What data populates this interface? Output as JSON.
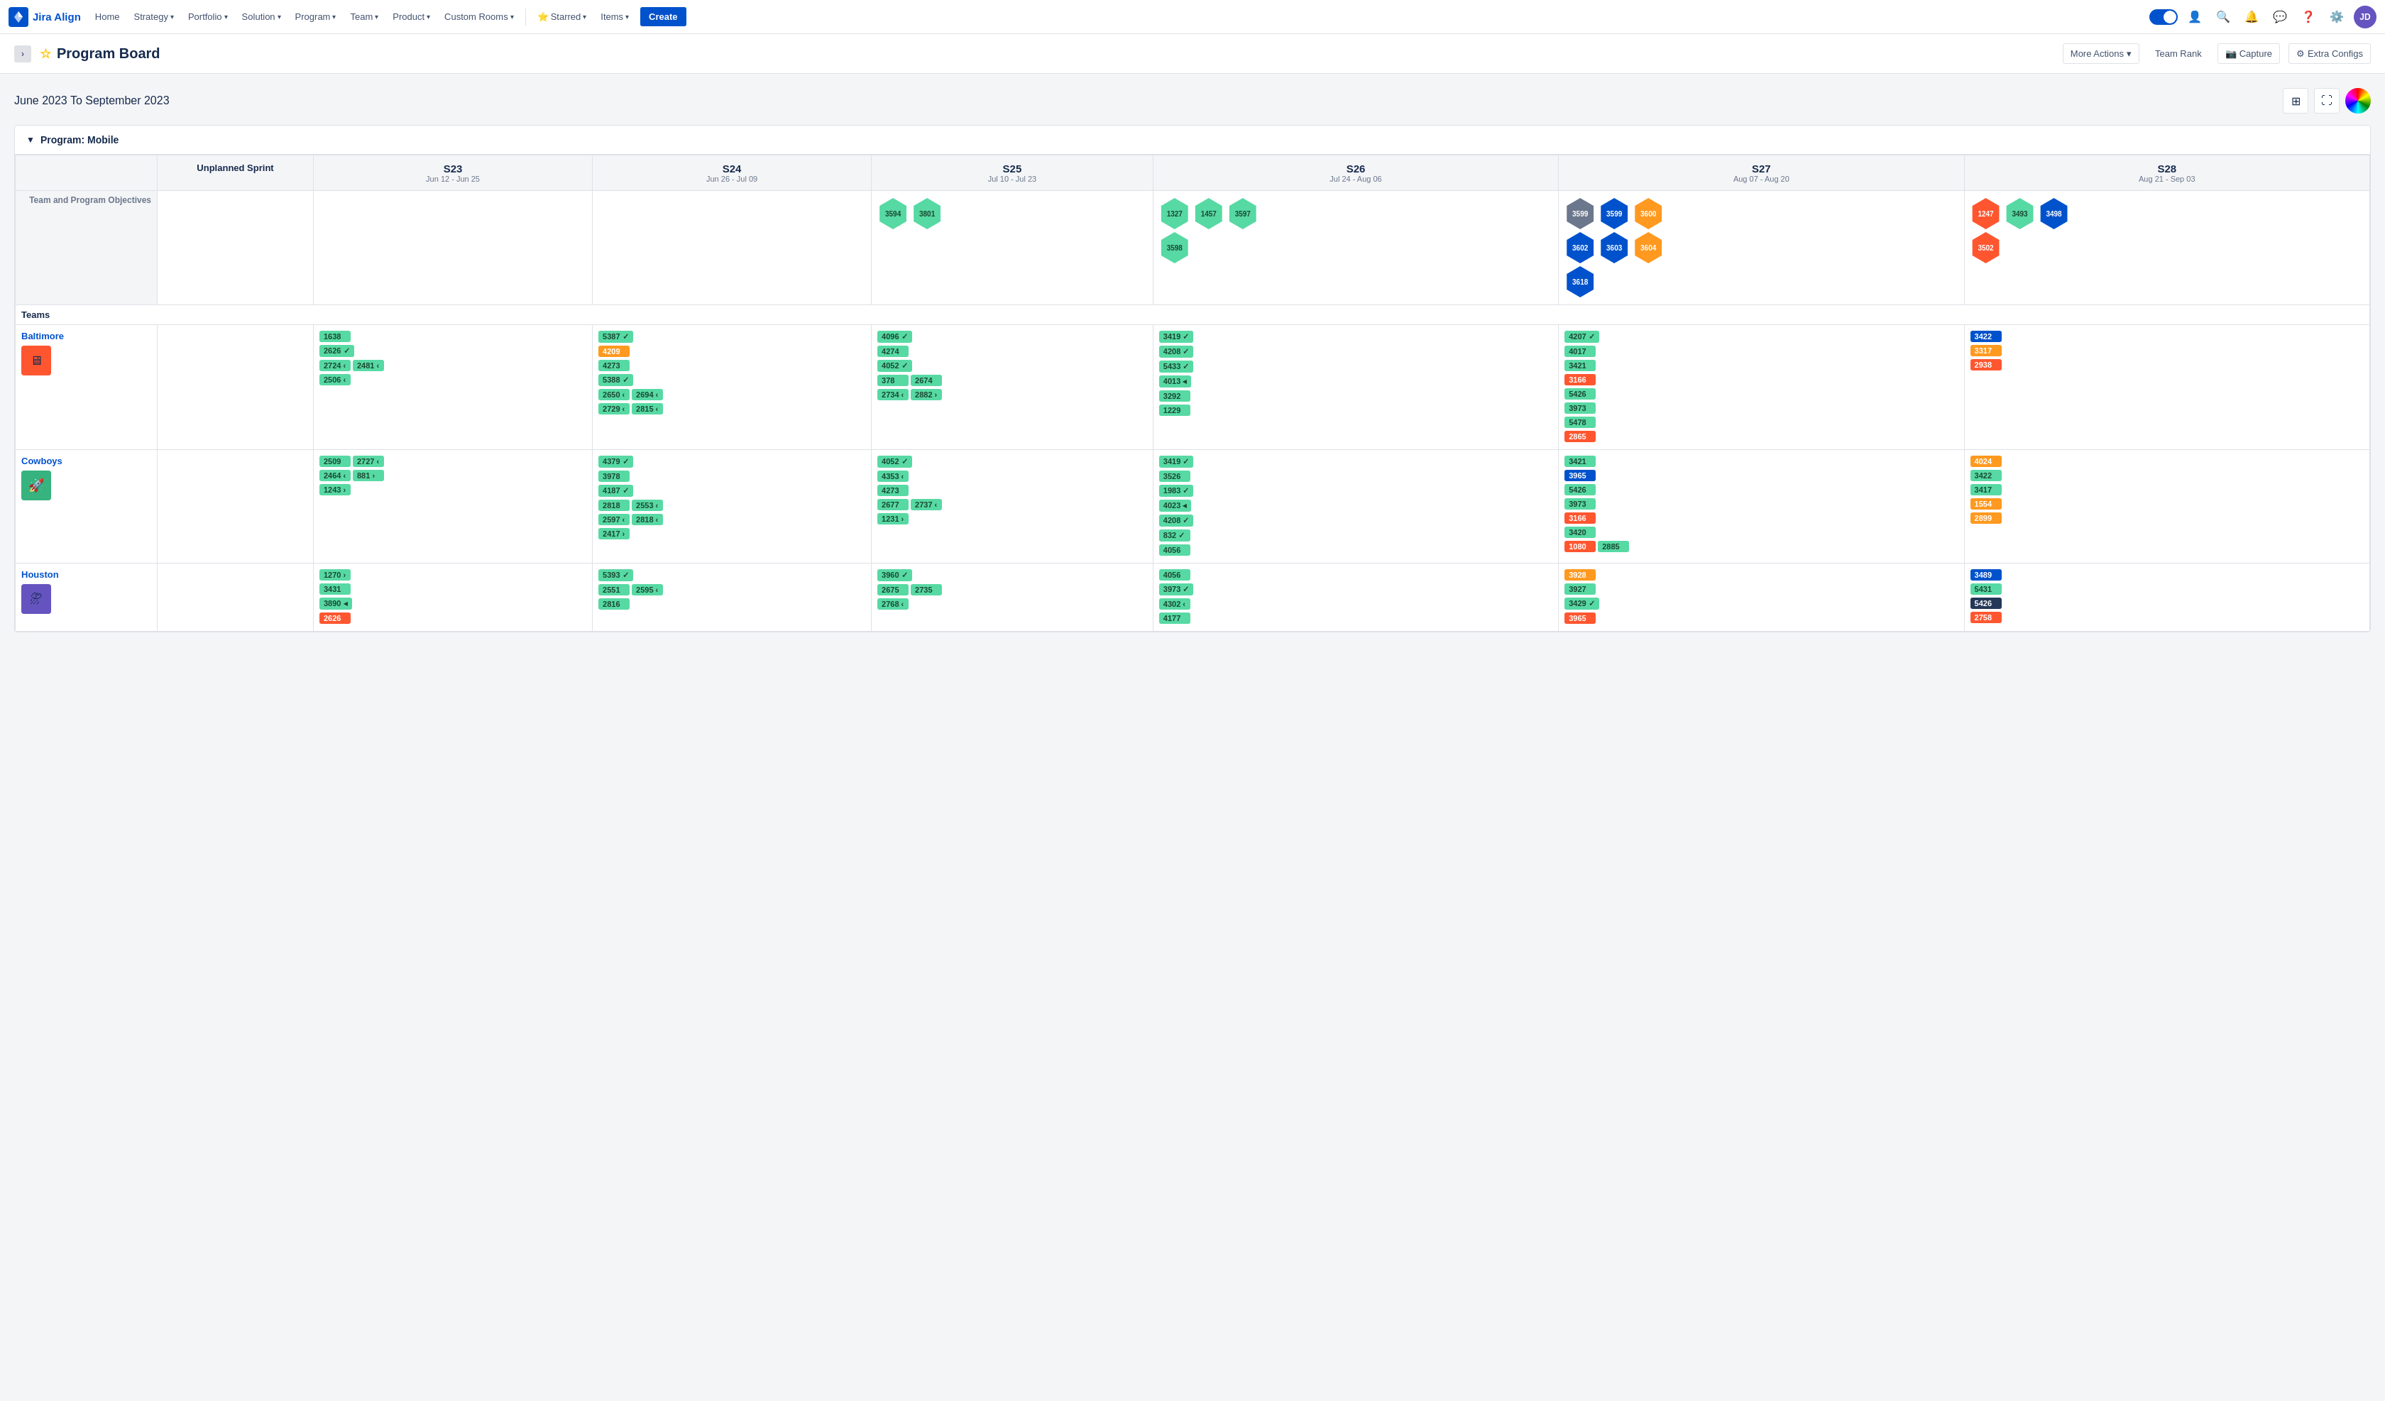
{
  "app": {
    "name": "Jira Align"
  },
  "nav": {
    "home": "Home",
    "strategy": "Strategy",
    "portfolio": "Portfolio",
    "solution": "Solution",
    "program": "Program",
    "team": "Team",
    "product": "Product",
    "custom_rooms": "Custom Rooms",
    "starred": "Starred",
    "items": "Items",
    "create": "Create"
  },
  "page": {
    "title": "Program Board",
    "more_actions": "More Actions",
    "team_rank": "Team Rank",
    "capture": "Capture",
    "extra_configs": "Extra Configs"
  },
  "board": {
    "date_range": "June 2023 To September 2023",
    "program_label": "Program: Mobile",
    "unplanned_sprint": "Unplanned Sprint",
    "section_objectives": "Team and Program Objectives",
    "section_teams": "Teams",
    "sprints": [
      {
        "id": "S23",
        "dates": "Jun 12 - Jun 25"
      },
      {
        "id": "S24",
        "dates": "Jun 26 - Jul 09"
      },
      {
        "id": "S25",
        "dates": "Jul 10 - Jul 23"
      },
      {
        "id": "S26",
        "dates": "Jul 24 - Aug 06"
      },
      {
        "id": "S27",
        "dates": "Aug 07 - Aug 20"
      },
      {
        "id": "S28",
        "dates": "Aug 21 - Sep 03"
      }
    ],
    "objectives": {
      "S23": [],
      "S24": [],
      "S25": [
        {
          "id": "3594",
          "color": "hex-green"
        },
        {
          "id": "3801",
          "color": "hex-green"
        }
      ],
      "S26": [
        {
          "id": "1327",
          "color": "hex-green"
        },
        {
          "id": "1457",
          "color": "hex-green"
        },
        {
          "id": "3597",
          "color": "hex-green"
        },
        {
          "id": "3598",
          "color": "hex-green"
        }
      ],
      "S27": [
        {
          "id": "3599",
          "color": "hex-blue"
        },
        {
          "id": "3599b",
          "color": "hex-blue"
        },
        {
          "id": "3600",
          "color": "hex-orange"
        },
        {
          "id": "3602",
          "color": "hex-blue"
        },
        {
          "id": "3603",
          "color": "hex-blue"
        },
        {
          "id": "3604",
          "color": "hex-orange"
        },
        {
          "id": "3618",
          "color": "hex-blue"
        }
      ],
      "S28": [
        {
          "id": "1247",
          "color": "hex-red"
        },
        {
          "id": "3493",
          "color": "hex-green"
        },
        {
          "id": "3498",
          "color": "hex-blue"
        },
        {
          "id": "3502",
          "color": "hex-red"
        }
      ]
    },
    "teams": [
      {
        "name": "Baltimore",
        "avatar_color": "#ff5630",
        "avatar_icon": "🖥",
        "sprints": {
          "S23": [
            [
              {
                "id": "1638",
                "color": "card-green"
              }
            ],
            [
              {
                "id": "2626",
                "color": "card-green",
                "indicator": "✓"
              }
            ],
            [
              {
                "id": "2724",
                "color": "card-green",
                "indicator": "‹"
              },
              {
                "id": "2481",
                "color": "card-green",
                "indicator": "‹"
              }
            ],
            [
              {
                "id": "2506",
                "color": "card-green",
                "indicator": "‹"
              }
            ]
          ],
          "S24": [
            [
              {
                "id": "5387",
                "color": "card-green",
                "indicator": "✓"
              }
            ],
            [
              {
                "id": "4209",
                "color": "card-orange"
              }
            ],
            [
              {
                "id": "4273",
                "color": "card-green"
              }
            ],
            [
              {
                "id": "5388",
                "color": "card-green",
                "indicator": "✓"
              }
            ],
            [
              {
                "id": "2650",
                "color": "card-green",
                "indicator": "‹"
              },
              {
                "id": "2694",
                "color": "card-green",
                "indicator": "‹"
              }
            ],
            [
              {
                "id": "2729",
                "color": "card-green",
                "indicator": "‹"
              },
              {
                "id": "2815",
                "color": "card-green",
                "indicator": "‹"
              }
            ]
          ],
          "S25": [
            [
              {
                "id": "4096",
                "color": "card-green",
                "indicator": "✓"
              }
            ],
            [
              {
                "id": "4274",
                "color": "card-green"
              }
            ],
            [
              {
                "id": "4052",
                "color": "card-green",
                "indicator": "✓"
              }
            ],
            [
              {
                "id": "378",
                "color": "card-green"
              },
              {
                "id": "2674",
                "color": "card-green"
              }
            ],
            [
              {
                "id": "2734",
                "color": "card-green",
                "indicator": "‹"
              },
              {
                "id": "2882",
                "color": "card-green",
                "indicator": "›"
              }
            ]
          ],
          "S26": [
            [
              {
                "id": "3419",
                "color": "card-green",
                "indicator": "✓"
              }
            ],
            [
              {
                "id": "4208",
                "color": "card-green",
                "indicator": "✓"
              }
            ],
            [
              {
                "id": "5433",
                "color": "card-green",
                "indicator": "✓"
              }
            ],
            [
              {
                "id": "4013",
                "color": "card-green",
                "indicator": "◂"
              }
            ],
            [
              {
                "id": "3292",
                "color": "card-green"
              }
            ],
            [
              {
                "id": "1229",
                "color": "card-green"
              }
            ]
          ],
          "S27": [
            [
              {
                "id": "4207",
                "color": "card-green",
                "indicator": "✓"
              }
            ],
            [
              {
                "id": "4017",
                "color": "card-green"
              }
            ],
            [
              {
                "id": "3421",
                "color": "card-green"
              }
            ],
            [
              {
                "id": "3166",
                "color": "card-red"
              }
            ],
            [
              {
                "id": "5426",
                "color": "card-green"
              }
            ],
            [
              {
                "id": "3973",
                "color": "card-green"
              }
            ],
            [
              {
                "id": "5478",
                "color": "card-green"
              }
            ],
            [
              {
                "id": "2865",
                "color": "card-red"
              }
            ]
          ],
          "S28": [
            [
              {
                "id": "3422",
                "color": "card-blue"
              }
            ],
            [
              {
                "id": "3317",
                "color": "card-orange"
              }
            ],
            [
              {
                "id": "2938",
                "color": "card-red"
              }
            ]
          ]
        }
      },
      {
        "name": "Cowboys",
        "avatar_color": "#36b37e",
        "avatar_icon": "🚀",
        "sprints": {
          "S23": [
            [
              {
                "id": "2509",
                "color": "card-green"
              },
              {
                "id": "2727",
                "color": "card-green",
                "indicator": "‹"
              }
            ],
            [
              {
                "id": "2464",
                "color": "card-green",
                "indicator": "‹"
              },
              {
                "id": "881",
                "color": "card-green",
                "indicator": "›"
              }
            ],
            [
              {
                "id": "1243",
                "color": "card-green",
                "indicator": "›"
              }
            ]
          ],
          "S24": [
            [
              {
                "id": "4379",
                "color": "card-green",
                "indicator": "✓"
              }
            ],
            [
              {
                "id": "3978",
                "color": "card-green"
              }
            ],
            [
              {
                "id": "4187",
                "color": "card-green",
                "indicator": "✓"
              }
            ],
            [
              {
                "id": "2818",
                "color": "card-green"
              },
              {
                "id": "2553",
                "color": "card-green",
                "indicator": "‹"
              }
            ],
            [
              {
                "id": "2597",
                "color": "card-green",
                "indicator": "‹"
              },
              {
                "id": "2818",
                "color": "card-green",
                "indicator": "‹"
              }
            ],
            [
              {
                "id": "2417",
                "color": "card-green",
                "indicator": "›"
              }
            ]
          ],
          "S25": [
            [
              {
                "id": "4052",
                "color": "card-green",
                "indicator": "✓"
              }
            ],
            [
              {
                "id": "4353",
                "color": "card-green",
                "indicator": "‹"
              }
            ],
            [
              {
                "id": "4273",
                "color": "card-green"
              }
            ],
            [
              {
                "id": "2677",
                "color": "card-green"
              },
              {
                "id": "2737",
                "color": "card-green",
                "indicator": "‹"
              }
            ],
            [
              {
                "id": "1231",
                "color": "card-green",
                "indicator": "›"
              }
            ]
          ],
          "S26": [
            [
              {
                "id": "3419",
                "color": "card-green",
                "indicator": "✓"
              }
            ],
            [
              {
                "id": "3526",
                "color": "card-green"
              }
            ],
            [
              {
                "id": "1983",
                "color": "card-green",
                "indicator": "✓"
              }
            ],
            [
              {
                "id": "4023",
                "color": "card-green",
                "indicator": "◂"
              }
            ],
            [
              {
                "id": "4208",
                "color": "card-green",
                "indicator": "✓"
              }
            ],
            [
              {
                "id": "832",
                "color": "card-green",
                "indicator": "✓"
              }
            ],
            [
              {
                "id": "4056",
                "color": "card-green"
              }
            ]
          ],
          "S27": [
            [
              {
                "id": "3421",
                "color": "card-green"
              }
            ],
            [
              {
                "id": "3965",
                "color": "card-blue"
              }
            ],
            [
              {
                "id": "5426",
                "color": "card-green"
              }
            ],
            [
              {
                "id": "3973",
                "color": "card-green"
              }
            ],
            [
              {
                "id": "3166",
                "color": "card-red"
              }
            ],
            [
              {
                "id": "3420",
                "color": "card-green"
              }
            ],
            [
              {
                "id": "1080",
                "color": "card-red"
              },
              {
                "id": "2885",
                "color": "card-green"
              }
            ]
          ],
          "S28": [
            [
              {
                "id": "4024",
                "color": "card-orange"
              }
            ],
            [
              {
                "id": "3422",
                "color": "card-green"
              }
            ],
            [
              {
                "id": "3417",
                "color": "card-green"
              }
            ],
            [
              {
                "id": "1554",
                "color": "card-orange"
              }
            ],
            [
              {
                "id": "2899",
                "color": "card-orange"
              }
            ]
          ]
        }
      },
      {
        "name": "Houston",
        "avatar_color": "#6554c0",
        "avatar_icon": "⛈",
        "sprints": {
          "S23": [
            [
              {
                "id": "1270",
                "color": "card-green",
                "indicator": "›"
              }
            ],
            [
              {
                "id": "3431",
                "color": "card-green"
              }
            ],
            [
              {
                "id": "3890",
                "color": "card-green",
                "indicator": "◂"
              }
            ],
            [
              {
                "id": "2626",
                "color": "card-red"
              }
            ]
          ],
          "S24": [
            [
              {
                "id": "5393",
                "color": "card-green",
                "indicator": "✓"
              }
            ],
            [
              {
                "id": "2551",
                "color": "card-green"
              },
              {
                "id": "2595",
                "color": "card-green",
                "indicator": "‹"
              }
            ],
            [
              {
                "id": "2816",
                "color": "card-green"
              }
            ]
          ],
          "S25": [
            [
              {
                "id": "3960",
                "color": "card-green",
                "indicator": "✓"
              }
            ],
            [
              {
                "id": "2675",
                "color": "card-green"
              },
              {
                "id": "2735",
                "color": "card-green"
              }
            ],
            [
              {
                "id": "2768",
                "color": "card-green",
                "indicator": "‹"
              }
            ]
          ],
          "S26": [
            [
              {
                "id": "4056",
                "color": "card-green"
              }
            ],
            [
              {
                "id": "3973",
                "color": "card-green",
                "indicator": "✓"
              }
            ],
            [
              {
                "id": "4302",
                "color": "card-green",
                "indicator": "‹"
              }
            ],
            [
              {
                "id": "4177",
                "color": "card-green"
              }
            ]
          ],
          "S27": [
            [
              {
                "id": "3928",
                "color": "card-orange"
              }
            ],
            [
              {
                "id": "3927",
                "color": "card-green"
              }
            ],
            [
              {
                "id": "3429",
                "color": "card-green",
                "indicator": "✓"
              }
            ],
            [
              {
                "id": "3965",
                "color": "card-red"
              }
            ]
          ],
          "S28": [
            [
              {
                "id": "3489",
                "color": "card-blue"
              }
            ],
            [
              {
                "id": "5431",
                "color": "card-green"
              }
            ],
            [
              {
                "id": "5426",
                "color": "card-dark"
              }
            ],
            [
              {
                "id": "2758",
                "color": "card-red"
              }
            ]
          ]
        }
      }
    ]
  }
}
